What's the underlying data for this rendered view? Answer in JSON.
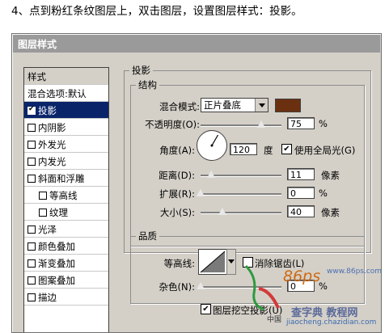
{
  "instruction": "4、点到粉红条纹图层上，双击图层，设置图层样式：投影。",
  "dialog_title": "图层样式",
  "left_panel": {
    "header": "样式",
    "items": [
      {
        "label": "混合选项:默认",
        "checkbox": false,
        "selected": false
      },
      {
        "label": "投影",
        "checkbox": true,
        "checked": true,
        "selected": true
      },
      {
        "label": "内阴影",
        "checkbox": true,
        "checked": false
      },
      {
        "label": "外发光",
        "checkbox": true,
        "checked": false
      },
      {
        "label": "内发光",
        "checkbox": true,
        "checked": false
      },
      {
        "label": "斜面和浮雕",
        "checkbox": true,
        "checked": false
      },
      {
        "label": "等高线",
        "checkbox": true,
        "checked": false,
        "indent": true
      },
      {
        "label": "纹理",
        "checkbox": true,
        "checked": false,
        "indent": true
      },
      {
        "label": "光泽",
        "checkbox": true,
        "checked": false
      },
      {
        "label": "颜色叠加",
        "checkbox": true,
        "checked": false
      },
      {
        "label": "渐变叠加",
        "checkbox": true,
        "checked": false
      },
      {
        "label": "图案叠加",
        "checkbox": true,
        "checked": false
      },
      {
        "label": "描边",
        "checkbox": true,
        "checked": false
      }
    ]
  },
  "shadow": {
    "group_title": "投影",
    "structure_title": "结构",
    "blend_mode_label": "混合模式:",
    "blend_mode_value": "正片叠底",
    "swatch_color": "#6b3010",
    "opacity_label": "不透明度(O):",
    "opacity_value": "75",
    "opacity_unit": "%",
    "opacity_fraction": 0.75,
    "angle_label": "角度(A):",
    "angle_value": "120",
    "angle_unit": "度",
    "global_light_label": "使用全局光(G)",
    "global_light_checked": true,
    "distance_label": "距离(D):",
    "distance_value": "11",
    "distance_unit": "像素",
    "spread_label": "扩展(R):",
    "spread_value": "0",
    "spread_unit": "%",
    "size_label": "大小(S):",
    "size_value": "40",
    "size_unit": "像素"
  },
  "quality": {
    "title": "品质",
    "contour_label": "等高线:",
    "antialias_label": "消除锯齿(L)",
    "antialias_checked": false,
    "noise_label": "杂色(N):",
    "noise_value": "0",
    "noise_unit": "%",
    "knockout_label": "图层挖空投影(U)",
    "knockout_checked": true
  },
  "watermarks": {
    "site_url": "www.86ps.com",
    "logo_text": "86ps",
    "site_label": "中国",
    "brand": "查字典 教程网",
    "brand_url": "jiaocheng.chazidian.com"
  }
}
